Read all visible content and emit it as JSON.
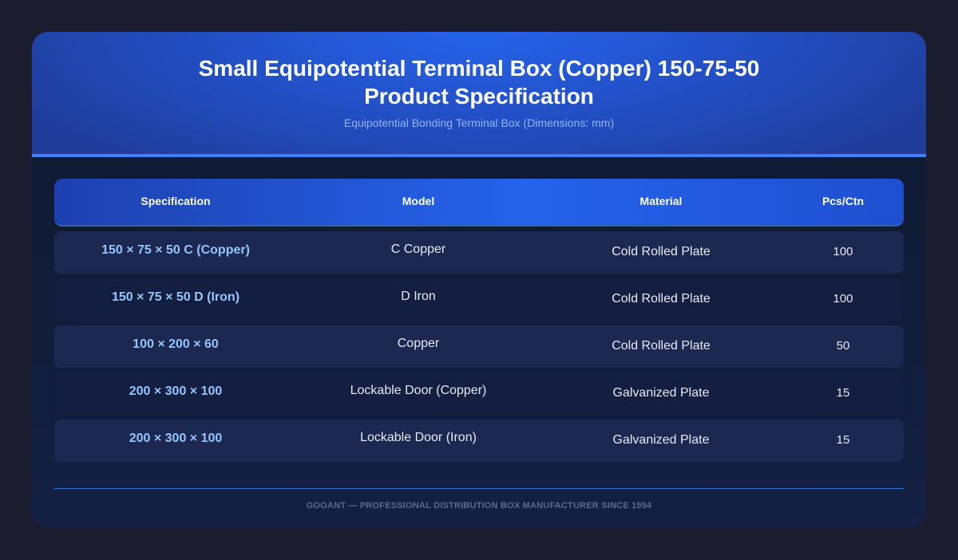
{
  "header": {
    "title_line1": "Small Equipotential Terminal Box (Copper) 150-75-50",
    "title_line2": "Product Specification",
    "subtitle": "Equipotential Bonding Terminal Box (Dimensions: mm)"
  },
  "table": {
    "columns": [
      "Specification",
      "Model",
      "Material",
      "Pcs/Ctn"
    ],
    "rows": [
      {
        "spec": "150 × 75 × 50 C (Copper)",
        "model": "C Copper",
        "material": "Cold Rolled Plate",
        "pcs": "100"
      },
      {
        "spec": "150 × 75 × 50 D (Iron)",
        "model": "D Iron",
        "material": "Cold Rolled Plate",
        "pcs": "100"
      },
      {
        "spec": "100 × 200 × 60",
        "model": "Copper",
        "material": "Cold Rolled Plate",
        "pcs": "50"
      },
      {
        "spec": "200 × 300 × 100",
        "model": "Lockable Door (Copper)",
        "material": "Galvanized Plate",
        "pcs": "15"
      },
      {
        "spec": "200 × 300 × 100",
        "model": "Lockable Door (Iron)",
        "material": "Galvanized Plate",
        "pcs": "15"
      }
    ]
  },
  "footer": {
    "text": "GOOANT — PROFESSIONAL DISTRIBUTION BOX MANUFACTURER SINCE 1994"
  },
  "colors": {
    "page_background": "#1b1c2e",
    "header_accent": "#2563eb",
    "spec_text": "#93c5fd",
    "row_odd": "#1c2850",
    "row_even": "#141e40"
  }
}
